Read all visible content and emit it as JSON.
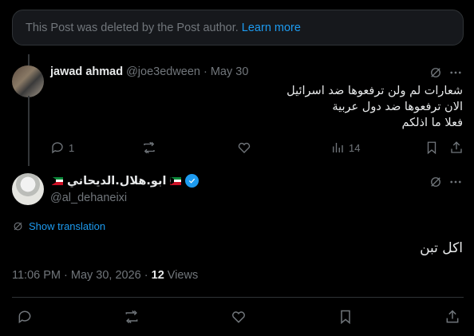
{
  "deleted_notice": {
    "text": "This Post was deleted by the Post author.",
    "link": "Learn more"
  },
  "reply": {
    "author_name": "jawad ahmad",
    "author_handle": "@joe3edween",
    "separator": "·",
    "date": "May 30",
    "text_lines": [
      "شعارات لم ولن ترفعوها ضد اسرائيل",
      "الان ترفعوها ضد دول عربية",
      "فعلا ما اذلكم"
    ],
    "actions": {
      "replies": "1",
      "reposts": "",
      "likes": "",
      "views": "14"
    }
  },
  "main_post": {
    "author_name": "ابو.هلال.الديحاني",
    "author_handle": "@al_dehaneixi",
    "show_translation": "Show translation",
    "text": "اكل تبن",
    "timestamp": "11:06 PM · May 30, 2026 · ",
    "views_count": "12",
    "views_label": " Views"
  },
  "colors": {
    "accent": "#1d9bf0",
    "muted": "#71767b",
    "background": "#000000",
    "divider": "#2f3336"
  }
}
